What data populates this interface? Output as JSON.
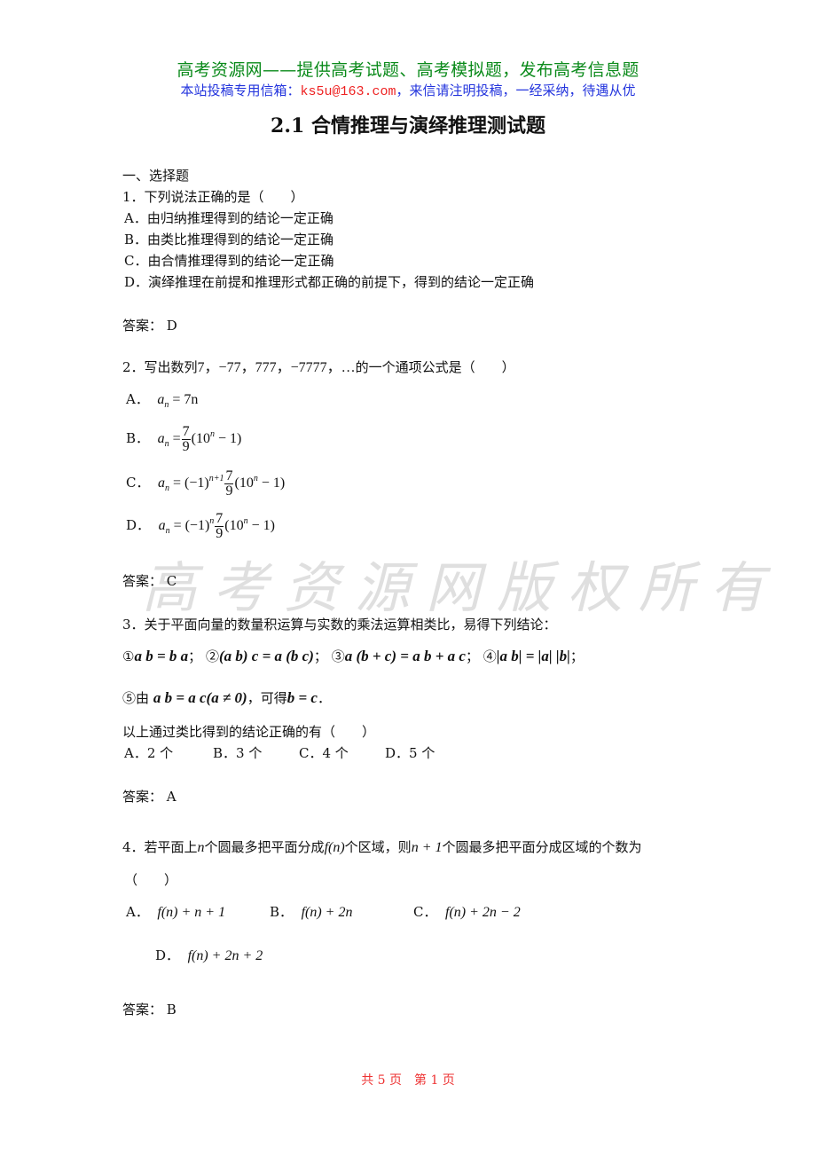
{
  "header": {
    "site_line": "高考资源网——提供高考试题、高考模拟题，发布高考信息题",
    "contact_prefix": "本站投稿专用信箱：",
    "contact_email": "ks5u@163.com",
    "contact_suffix": "，来信请注明投稿，一经采纳，待遇从优",
    "colors": {
      "site_line": "#0a8a1a",
      "contact": "#2233dd",
      "email": "#ee2222"
    }
  },
  "title": "2.1 合情推理与演绎推理测试题",
  "section": "一、选择题",
  "watermark": "高考资源网版权所有",
  "answer_label": "答案：",
  "questions": [
    {
      "stem": "1．下列说法正确的是（　　）",
      "options": [
        "A．由归纳推理得到的结论一定正确",
        "B．由类比推理得到的结论一定正确",
        "C．由合情推理得到的结论一定正确",
        "D．演绎推理在前提和推理形式都正确的前提下，得到的结论一定正确"
      ],
      "answer": "D"
    },
    {
      "stem_prefix": "2．写出数列",
      "sequence": "7，−77，777，−7777，…",
      "stem_suffix": "的一个通项公式是（　　）",
      "options": [
        {
          "label": "A．",
          "lhs": "a",
          "sub": "n",
          "rhs": "= 7n"
        },
        {
          "label": "B．",
          "lhs": "a",
          "sub": "n",
          "frac_num": "7",
          "frac_den": "9",
          "tail": "(10",
          "tail_sup": "n",
          "tail_end": " − 1)"
        },
        {
          "label": "C．",
          "lhs": "a",
          "sub": "n",
          "sign": "= (−1)",
          "sign_sup": "n+1",
          "frac_num": "7",
          "frac_den": "9",
          "tail": "(10",
          "tail_sup": "n",
          "tail_end": " − 1)"
        },
        {
          "label": "D．",
          "lhs": "a",
          "sub": "n",
          "sign": "= (−1)",
          "sign_sup": "n",
          "frac_num": "7",
          "frac_den": "9",
          "tail": "(10",
          "tail_sup": "n",
          "tail_end": " − 1)"
        }
      ],
      "answer": "C"
    },
    {
      "stem": "3．关于平面向量的数量积运算与实数的乘法运算相类比，易得下列结论：",
      "conclusions": [
        {
          "num": "①",
          "expr": "a b = b a",
          "sep": "；"
        },
        {
          "num": "②",
          "expr": "(a b) c = a (b c)",
          "sep": "；"
        },
        {
          "num": "③",
          "expr": "a (b + c) = a b + a c",
          "sep": "；"
        },
        {
          "num": "④",
          "expr": "|a b| = |a| |b|",
          "sep": "；"
        }
      ],
      "conclusion5": {
        "num": "⑤",
        "pre": "由",
        "expr1": "a b = a c(a ≠ 0)",
        "mid": "，可得",
        "expr2": "b = c",
        "end": "．"
      },
      "stem2": "以上通过类比得到的结论正确的有（　　）",
      "options": [
        "A．2 个",
        "B．3 个",
        "C．4 个",
        "D．5 个"
      ],
      "answer": "A"
    },
    {
      "stem_p1": "4．若平面上",
      "n": "n",
      "stem_p2": "个圆最多把平面分成",
      "fn": "f(n)",
      "stem_p3": "个区域，则",
      "n1": "n + 1",
      "stem_p4": "个圆最多把平面分成区域的个数为",
      "stem_line2": "（　　）",
      "options": [
        {
          "label": "A．",
          "expr": "f(n) + n + 1"
        },
        {
          "label": "B．",
          "expr": "f(n) + 2n"
        },
        {
          "label": "C．",
          "expr": "f(n) + 2n − 2"
        },
        {
          "label": "D．",
          "expr": "f(n) + 2n + 2"
        }
      ],
      "answer": "B"
    }
  ],
  "footer": {
    "text": "共 5 页　第 1 页",
    "color": "#ee3333"
  }
}
